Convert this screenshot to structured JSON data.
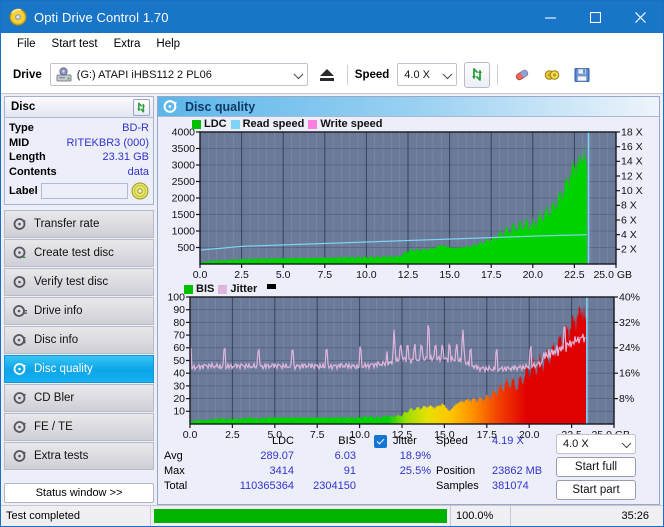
{
  "window": {
    "title": "Opti Drive Control 1.70",
    "icon": "disc-icon",
    "minimize": "─",
    "maximize": "☐",
    "close": "✕"
  },
  "menu": {
    "items": [
      "File",
      "Start test",
      "Extra",
      "Help"
    ]
  },
  "toolbar": {
    "drive_label": "Drive",
    "drive_value": "(G:)  ATAPI iHBS112  2 PL06",
    "eject_icon": "eject-icon",
    "speed_label": "Speed",
    "speed_value": "4.0 X",
    "refresh_icon": "refresh-icon",
    "erase_icon": "eraser-icon",
    "tools_icon": "tools-icon",
    "save_icon": "save-icon"
  },
  "sidebar": {
    "disc": {
      "title": "Disc",
      "refresh_icon": "refresh-icon",
      "rows": [
        {
          "key": "Type",
          "value": "BD-R"
        },
        {
          "key": "MID",
          "value": "RITEKBR3 (000)"
        },
        {
          "key": "Length",
          "value": "23.31 GB"
        },
        {
          "key": "Contents",
          "value": "data"
        }
      ],
      "label_key": "Label",
      "label_value": "",
      "label_icon": "disc-icon"
    },
    "nav": [
      {
        "label": "Transfer rate",
        "icon": "disc-test-icon",
        "active": false
      },
      {
        "label": "Create test disc",
        "icon": "disc-create-icon",
        "active": false
      },
      {
        "label": "Verify test disc",
        "icon": "disc-verify-icon",
        "active": false
      },
      {
        "label": "Drive info",
        "icon": "drive-info-icon",
        "active": false
      },
      {
        "label": "Disc info",
        "icon": "disc-info-icon",
        "active": false
      },
      {
        "label": "Disc quality",
        "icon": "disc-quality-icon",
        "active": true
      },
      {
        "label": "CD Bler",
        "icon": "cd-bler-icon",
        "active": false
      },
      {
        "label": "FE / TE",
        "icon": "fe-te-icon",
        "active": false
      },
      {
        "label": "Extra tests",
        "icon": "extra-tests-icon",
        "active": false
      }
    ],
    "status_window_button": "Status window >>"
  },
  "panel": {
    "title": "Disc quality",
    "icon": "disc-quality-icon"
  },
  "stats": {
    "col_ldc": "LDC",
    "col_bis": "BIS",
    "rows": [
      {
        "label": "Avg",
        "ldc": "289.07",
        "bis": "6.03",
        "jitter": "18.9%"
      },
      {
        "label": "Max",
        "ldc": "3414",
        "bis": "91",
        "jitter": "25.5%"
      },
      {
        "label": "Total",
        "ldc": "110365364",
        "bis": "2304150",
        "jitter": ""
      }
    ],
    "jitter_label": "Jitter",
    "jitter_checked": true,
    "speed_label": "Speed",
    "speed_value": "4.19 X",
    "position_label": "Position",
    "position_value": "23862 MB",
    "samples_label": "Samples",
    "samples_value": "381074",
    "speed_select": "4.0 X",
    "start_full": "Start full",
    "start_part": "Start part"
  },
  "statusbar": {
    "message": "Test completed",
    "percent": "100.0%",
    "elapsed": "35:26",
    "progress": 100
  },
  "colors": {
    "accent": "#1975c8",
    "ldc_green": "#00d200",
    "read_speed": "#7fd4f5",
    "write_speed": "#ff7fe0",
    "jitter_pink": "#e0b4dc",
    "bis_red": "#e00000",
    "plot_bg": "#6b7a99",
    "value_blue": "#3333cc"
  },
  "chart_data": [
    {
      "type": "area",
      "title": "LDC / Read speed",
      "xlabel": "GB",
      "ylabel": "LDC",
      "xlim": [
        0.0,
        25.0
      ],
      "xticks": [
        "0.0",
        "2.5",
        "5.0",
        "7.5",
        "10.0",
        "12.5",
        "15.0",
        "17.5",
        "20.0",
        "22.5",
        "25.0 GB"
      ],
      "ylim": [
        0,
        4000
      ],
      "yticks": [
        "500",
        "1000",
        "1500",
        "2000",
        "2500",
        "3000",
        "3500",
        "4000"
      ],
      "y2lim": [
        0,
        18
      ],
      "y2ticks": [
        "2 X",
        "4 X",
        "6 X",
        "8 X",
        "10 X",
        "12 X",
        "14 X",
        "16 X",
        "18 X"
      ],
      "grid": true,
      "legend": [
        {
          "name": "LDC",
          "color": "#00c000"
        },
        {
          "name": "Read speed",
          "color": "#7fd4f5"
        },
        {
          "name": "Write speed",
          "color": "#ff7fe0"
        }
      ],
      "series": [
        {
          "name": "LDC",
          "type": "area",
          "color": "#00d200",
          "x": [
            0.0,
            0.5,
            1.0,
            1.5,
            2.0,
            2.5,
            3.0,
            3.5,
            4.0,
            4.5,
            5.0,
            5.5,
            6.0,
            6.5,
            7.0,
            7.5,
            8.0,
            8.5,
            9.0,
            9.5,
            10.0,
            10.5,
            11.0,
            11.5,
            12.0,
            12.5,
            12.8,
            13.2,
            13.6,
            14.0,
            14.4,
            14.8,
            15.2,
            15.6,
            16.0,
            16.4,
            16.8,
            17.2,
            17.6,
            18.0,
            18.4,
            18.8,
            19.2,
            19.6,
            20.0,
            20.4,
            20.8,
            21.2,
            21.6,
            22.0,
            22.4,
            22.8,
            23.1,
            23.3
          ],
          "values": [
            40,
            90,
            100,
            110,
            130,
            140,
            150,
            160,
            160,
            170,
            170,
            175,
            180,
            180,
            185,
            190,
            190,
            195,
            200,
            200,
            205,
            210,
            215,
            220,
            230,
            400,
            430,
            420,
            450,
            470,
            560,
            540,
            480,
            500,
            520,
            560,
            620,
            700,
            760,
            900,
            1000,
            1080,
            1150,
            1220,
            1180,
            1400,
            1550,
            1700,
            2000,
            2400,
            2900,
            3100,
            3414,
            2600
          ]
        },
        {
          "name": "Read speed",
          "type": "line",
          "color": "#7fd4f5",
          "x": [
            0.0,
            2.5,
            5.0,
            7.5,
            10.0,
            12.5,
            15.0,
            17.5,
            20.0,
            22.5,
            23.3
          ],
          "values": [
            1.9,
            2.4,
            2.6,
            2.8,
            3.0,
            3.2,
            3.4,
            3.6,
            3.8,
            3.95,
            4.0
          ]
        },
        {
          "name": "Write speed",
          "type": "line",
          "color": "#ff7fe0",
          "x": [],
          "values": []
        }
      ],
      "marker_x": 23.35
    },
    {
      "type": "area",
      "title": "BIS / Jitter",
      "xlabel": "GB",
      "ylabel": "BIS",
      "xlim": [
        0.0,
        25.0
      ],
      "xticks": [
        "0.0",
        "2.5",
        "5.0",
        "7.5",
        "10.0",
        "12.5",
        "15.0",
        "17.5",
        "20.0",
        "22.5",
        "25.0 GB"
      ],
      "ylim": [
        0,
        100
      ],
      "yticks": [
        "10",
        "20",
        "30",
        "40",
        "50",
        "60",
        "70",
        "80",
        "90",
        "100"
      ],
      "y2lim": [
        0,
        40
      ],
      "y2ticks": [
        "8%",
        "16%",
        "24%",
        "32%",
        "40%"
      ],
      "grid": true,
      "legend": [
        {
          "name": "BIS",
          "color": "#00c000"
        },
        {
          "name": "Jitter",
          "color": "#e0b4dc"
        }
      ],
      "series": [
        {
          "name": "BIS",
          "type": "area",
          "color": "gradient-green-yellow-red",
          "x": [
            0.0,
            0.5,
            1.0,
            1.5,
            2.0,
            2.5,
            3.0,
            3.5,
            4.0,
            4.5,
            5.0,
            5.5,
            6.0,
            6.5,
            7.0,
            7.5,
            8.0,
            8.5,
            9.0,
            9.5,
            10.0,
            10.5,
            11.0,
            11.5,
            12.0,
            12.5,
            12.9,
            13.3,
            13.7,
            14.1,
            14.5,
            14.9,
            15.3,
            15.7,
            16.1,
            16.5,
            16.9,
            17.3,
            17.7,
            18.1,
            18.5,
            18.9,
            19.3,
            19.7,
            20.1,
            20.5,
            20.9,
            21.3,
            21.7,
            22.1,
            22.5,
            22.9,
            23.2,
            23.35
          ],
          "values": [
            2,
            3,
            3,
            4,
            4,
            4,
            4,
            5,
            4,
            5,
            5,
            5,
            5,
            5,
            5,
            5,
            5,
            5,
            5,
            5,
            5,
            6,
            5,
            6,
            6,
            7,
            11,
            12,
            13,
            14,
            13,
            16,
            10,
            16,
            18,
            19,
            19,
            20,
            22,
            26,
            30,
            33,
            30,
            38,
            44,
            46,
            50,
            55,
            62,
            70,
            78,
            86,
            91,
            80
          ]
        },
        {
          "name": "Jitter",
          "type": "line",
          "color": "#e0b4dc",
          "x": [
            0.0,
            1.0,
            2.0,
            3.0,
            4.0,
            5.0,
            6.0,
            7.0,
            8.0,
            9.0,
            10.0,
            11.0,
            12.0,
            12.5,
            13.0,
            14.0,
            15.0,
            16.0,
            17.0,
            18.0,
            19.0,
            20.0,
            21.0,
            22.0,
            22.8,
            23.3
          ],
          "values": [
            17.6,
            18.4,
            18.0,
            18.4,
            18.0,
            18.4,
            18.0,
            18.4,
            18.0,
            18.4,
            18.0,
            18.8,
            19.2,
            20.8,
            20.0,
            20.8,
            20.4,
            20.0,
            17.6,
            17.2,
            17.6,
            18.0,
            19.6,
            22.0,
            24.4,
            25.5
          ]
        }
      ],
      "marker_x": 23.4
    }
  ]
}
